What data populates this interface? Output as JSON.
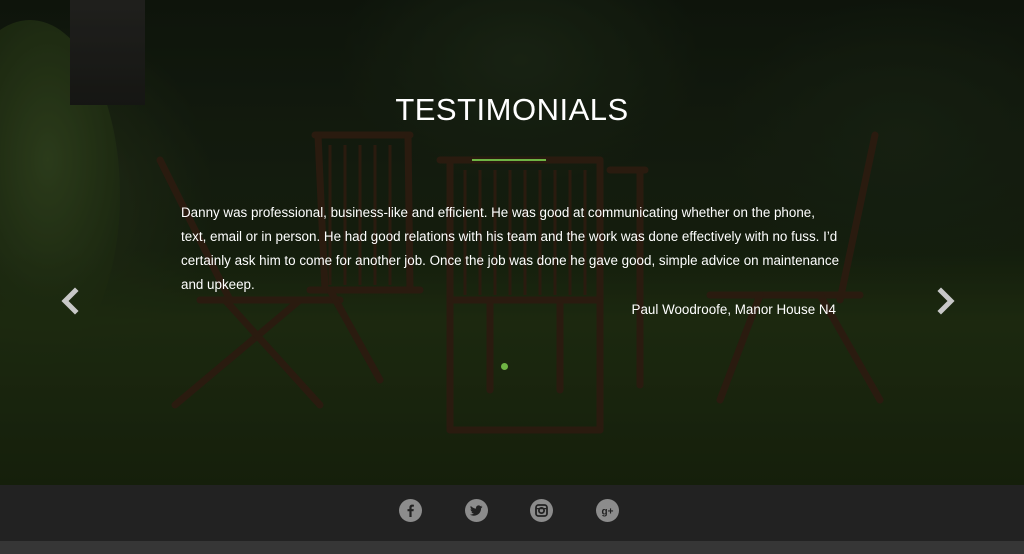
{
  "testimonials": {
    "title": "TESTIMONIALS",
    "quote": "Danny was professional, business-like and efficient. He was good at communicating whether on the phone, text, email or in person. He had good relations with his team and the work was done effectively with no fuss. I’d certainly ask him to come for another job. Once the job was done he gave good, simple advice on maintenance and upkeep.",
    "author": "Paul Woodroofe, Manor House N4",
    "accent_color": "#6fb544",
    "navigation": {
      "prev_icon": "chevron-left-icon",
      "next_icon": "chevron-right-icon",
      "indicators": [
        {
          "active": true
        }
      ]
    }
  },
  "footer": {
    "background_color": "#222222",
    "social_icons": [
      "facebook-icon",
      "twitter-icon",
      "instagram-icon",
      "google-plus-icon"
    ]
  }
}
